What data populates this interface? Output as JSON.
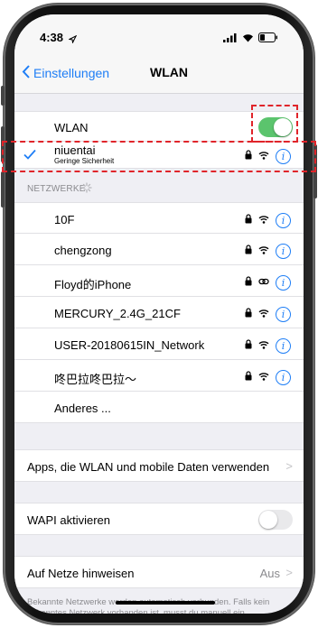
{
  "status_bar": {
    "time": "4:38"
  },
  "navbar": {
    "back_label": "Einstellungen",
    "title": "WLAN"
  },
  "wlan_row": {
    "label": "WLAN",
    "toggle_state": "on"
  },
  "connected_network": {
    "name": "niuentai",
    "subtitle": "Geringe Sicherheit",
    "locked": true
  },
  "networks_header": "NETZWERKE",
  "networks": [
    {
      "name": "10F",
      "locked": true,
      "signal": "wifi-icon"
    },
    {
      "name": "chengzong",
      "locked": true,
      "signal": "wifi-icon"
    },
    {
      "name": "Floyd的iPhone",
      "locked": true,
      "signal": "hotspot-icon"
    },
    {
      "name": "MERCURY_2.4G_21CF",
      "locked": true,
      "signal": "wifi-icon"
    },
    {
      "name": "USER-20180615IN_Network",
      "locked": true,
      "signal": "wifi-icon"
    },
    {
      "name": "咚巴拉咚巴拉～",
      "locked": true,
      "signal": "wifi-icon"
    }
  ],
  "other_network": "Anderes ...",
  "apps_row": {
    "label": "Apps, die WLAN und mobile Daten verwenden"
  },
  "wapi_row": {
    "label": "WAPI aktivieren",
    "toggle_state": "off"
  },
  "join_row": {
    "label": "Auf Netze hinweisen",
    "value": "Aus"
  },
  "footer": "Bekannte Netzwerke werden automatisch verbunden. Falls kein bekanntes Netzwerk vorhanden ist, musst du manuell ein",
  "colors": {
    "accent": "#1e7ef6",
    "toggle_on": "#5bc46d",
    "annotation": "#e0242a"
  }
}
